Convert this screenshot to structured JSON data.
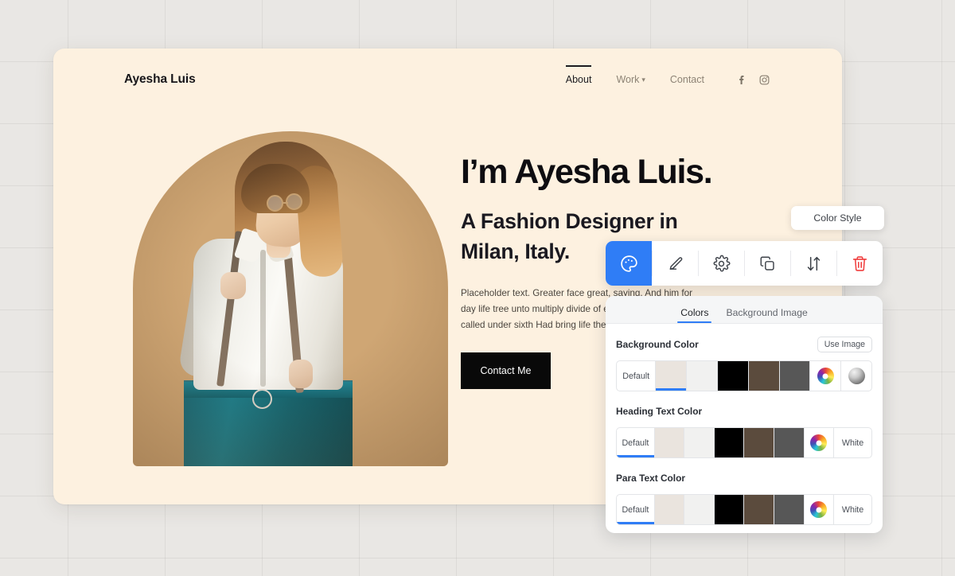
{
  "site": {
    "brand": "Ayesha Luis",
    "nav": [
      {
        "label": "About",
        "active": true
      },
      {
        "label": "Work",
        "active": false,
        "has_chevron": true
      },
      {
        "label": "Contact",
        "active": false
      }
    ],
    "socials": [
      {
        "name": "facebook-icon"
      },
      {
        "name": "instagram-icon"
      }
    ],
    "hero": {
      "title": "I’m Ayesha Luis.",
      "subtitle": "A Fashion Designer in Milan, Italy.",
      "paragraph": "Placeholder text. Greater face great, saying. And him for day life tree unto multiply divide of every multiply face two called under sixth Had bring life there",
      "cta_label": "Contact Me"
    }
  },
  "tooltip": {
    "label": "Color Style"
  },
  "toolbar": {
    "items": [
      {
        "name": "color-style-tool",
        "icon": "palette-icon",
        "active": true
      },
      {
        "name": "edit-tool",
        "icon": "pencil-icon",
        "active": false
      },
      {
        "name": "settings-tool",
        "icon": "gear-icon",
        "active": false
      },
      {
        "name": "duplicate-tool",
        "icon": "copy-icon",
        "active": false
      },
      {
        "name": "reorder-tool",
        "icon": "sort-arrows-icon",
        "active": false
      },
      {
        "name": "delete-tool",
        "icon": "trash-icon",
        "active": false
      }
    ],
    "accent_color": "#2f7df6",
    "delete_color": "#f03e3e"
  },
  "panel": {
    "tabs": [
      {
        "label": "Colors",
        "active": true
      },
      {
        "label": "Background Image",
        "active": false
      }
    ],
    "use_image_label": "Use Image",
    "sections": [
      {
        "title": "Background Color",
        "has_use_image": true,
        "swatches": [
          {
            "type": "label",
            "label": "Default",
            "color": "#ffffff",
            "selected": false
          },
          {
            "type": "color",
            "label": "",
            "color": "#eae4de",
            "selected": true
          },
          {
            "type": "color",
            "label": "",
            "color": "#f1f1f0",
            "selected": false
          },
          {
            "type": "color",
            "label": "",
            "color": "#000000",
            "selected": false
          },
          {
            "type": "color",
            "label": "",
            "color": "#5b4b3d",
            "selected": false
          },
          {
            "type": "color",
            "label": "",
            "color": "#575757",
            "selected": false
          },
          {
            "type": "wheel",
            "label": "",
            "color": "",
            "selected": false
          },
          {
            "type": "sphere",
            "label": "",
            "color": "",
            "selected": false
          }
        ]
      },
      {
        "title": "Heading Text Color",
        "has_use_image": false,
        "swatches": [
          {
            "type": "label",
            "label": "Default",
            "color": "#ffffff",
            "selected": true
          },
          {
            "type": "color",
            "label": "",
            "color": "#eae4de",
            "selected": false
          },
          {
            "type": "color",
            "label": "",
            "color": "#f1f1f0",
            "selected": false
          },
          {
            "type": "color",
            "label": "",
            "color": "#000000",
            "selected": false
          },
          {
            "type": "color",
            "label": "",
            "color": "#5b4b3d",
            "selected": false
          },
          {
            "type": "color",
            "label": "",
            "color": "#575757",
            "selected": false
          },
          {
            "type": "wheel",
            "label": "",
            "color": "",
            "selected": false
          },
          {
            "type": "label",
            "label": "White",
            "color": "#ffffff",
            "selected": false
          }
        ]
      },
      {
        "title": "Para Text Color",
        "has_use_image": false,
        "swatches": [
          {
            "type": "label",
            "label": "Default",
            "color": "#ffffff",
            "selected": true
          },
          {
            "type": "color",
            "label": "",
            "color": "#eae4de",
            "selected": false
          },
          {
            "type": "color",
            "label": "",
            "color": "#f1f1f0",
            "selected": false
          },
          {
            "type": "color",
            "label": "",
            "color": "#000000",
            "selected": false
          },
          {
            "type": "color",
            "label": "",
            "color": "#5b4b3d",
            "selected": false
          },
          {
            "type": "color",
            "label": "",
            "color": "#575757",
            "selected": false
          },
          {
            "type": "wheel",
            "label": "",
            "color": "",
            "selected": false
          },
          {
            "type": "label",
            "label": "White",
            "color": "#ffffff",
            "selected": false
          }
        ]
      }
    ]
  }
}
